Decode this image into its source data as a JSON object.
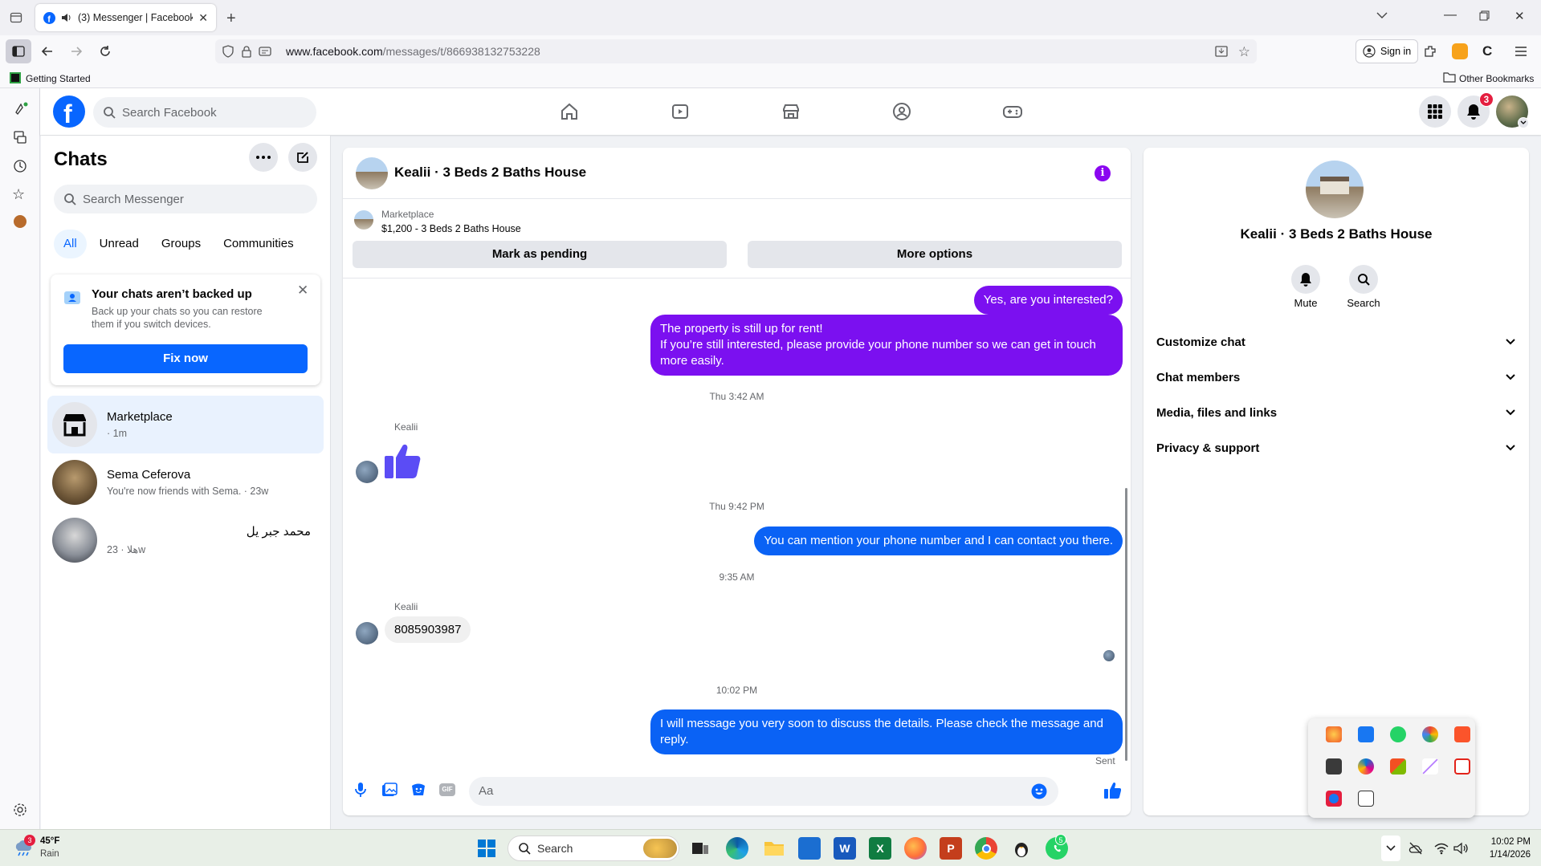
{
  "browser": {
    "tab_title": "(3) Messenger | Facebook",
    "url_host": "www.facebook.com",
    "url_path": "/messages/t/866938132753228",
    "sign_in": "Sign in",
    "bookmark_getting_started": "Getting Started",
    "bookmark_other": "Other Bookmarks"
  },
  "header": {
    "search_placeholder": "Search Facebook",
    "notification_count": "3"
  },
  "chats": {
    "title": "Chats",
    "search_placeholder": "Search Messenger",
    "filters": [
      "All",
      "Unread",
      "Groups",
      "Communities"
    ],
    "backup_title": "Your chats aren’t backed up",
    "backup_text": "Back up your chats so you can restore them if you switch devices.",
    "fix_now": "Fix now",
    "items": [
      {
        "name": "Marketplace",
        "preview": "· 1m"
      },
      {
        "name": "Sema Ceferova",
        "preview": "You're now friends with Sema. · 23w"
      },
      {
        "name": "محمد جبر يل",
        "preview": "هلا · 23w"
      }
    ]
  },
  "conversation": {
    "title": "Kealii · 3 Beds 2 Baths House",
    "marketplace_label": "Marketplace",
    "listing": "$1,200 - 3 Beds 2 Baths House",
    "mark_pending": "Mark as pending",
    "more_options": "More options",
    "msg1": "Yes, are you interested?",
    "msg2_line1": "The property is still up for rent!",
    "msg2_line2": "If you’re still interested, please provide your phone number so we can get in touch more easily.",
    "stamp1": "Thu 3:42 AM",
    "sender": "Kealii",
    "stamp2": "Thu 9:42 PM",
    "msg3": "You can mention your phone number and I can contact you there.",
    "stamp3": "9:35 AM",
    "msg4": "8085903987",
    "stamp4": "10:02 PM",
    "msg5": "I will message you very soon to discuss the details. Please check the message and reply.",
    "sent": "Sent",
    "composer_placeholder": "Aa"
  },
  "info_panel": {
    "name": "Kealii · 3 Beds 2 Baths House",
    "mute": "Mute",
    "search": "Search",
    "sections": [
      "Customize chat",
      "Chat members",
      "Media, files and links",
      "Privacy & support"
    ]
  },
  "taskbar": {
    "weather_temp": "45°F",
    "weather_desc": "Rain",
    "weather_badge": "3",
    "search": "Search",
    "whatsapp_badge": "5",
    "time": "10:02 PM",
    "date": "1/14/2026"
  },
  "colors": {
    "fb_blue": "#0866ff",
    "purple_bubble": "#7b10f0",
    "blue_bubble": "#0a62f5"
  }
}
